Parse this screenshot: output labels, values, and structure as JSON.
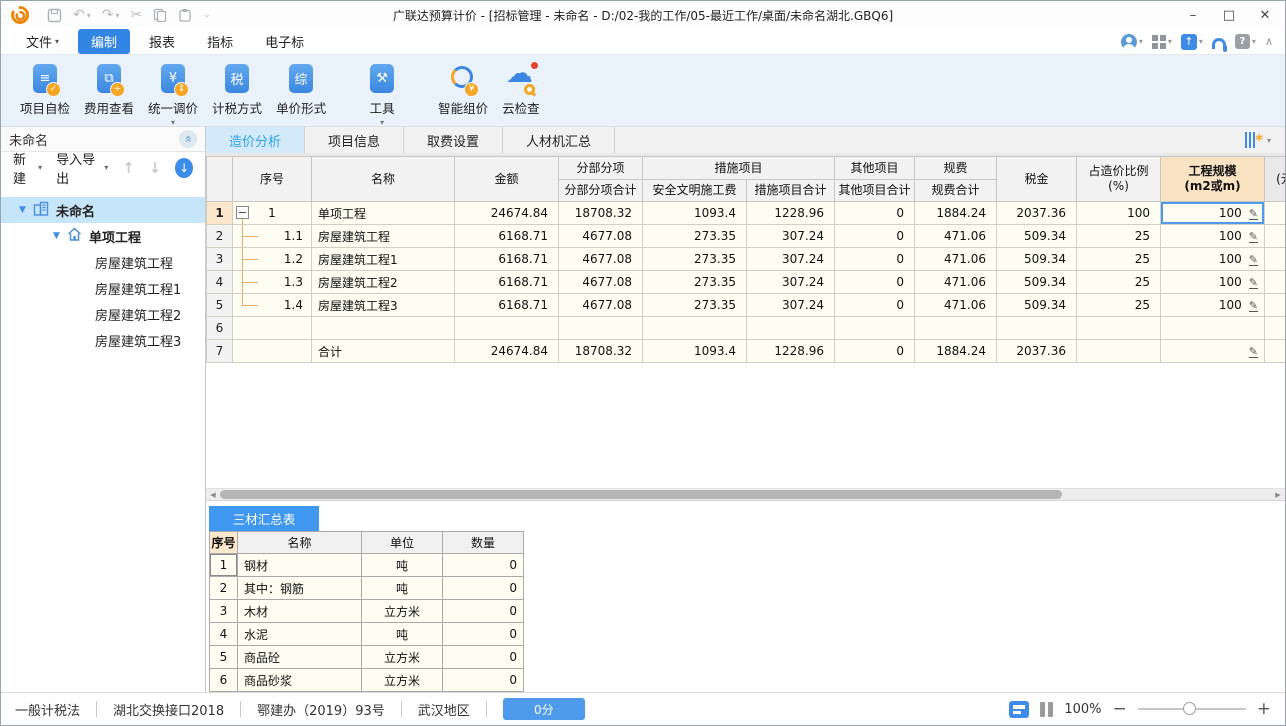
{
  "window": {
    "title": "广联达预算计价 - [招标管理 - 未命名 - D:/02-我的工作/05-最近工作/桌面/未命名湖北.GBQ6]",
    "controls": {
      "minimize": "–",
      "maximize": "□",
      "close": "✕"
    }
  },
  "menu": {
    "items": [
      {
        "label": "文件",
        "name": "file",
        "dropdown": true
      },
      {
        "label": "编制",
        "name": "edit",
        "active": true
      },
      {
        "label": "报表",
        "name": "report"
      },
      {
        "label": "指标",
        "name": "index"
      },
      {
        "label": "电子标",
        "name": "e-tender"
      }
    ]
  },
  "toolbar": {
    "buttons": [
      {
        "label": "项目自检",
        "name": "project-self-check",
        "icon": "doc-check"
      },
      {
        "label": "费用查看",
        "name": "fee-view",
        "icon": "fee-view"
      },
      {
        "label": "统一调价",
        "name": "unified-price-adjust",
        "icon": "adjust-price",
        "dropdown": true
      },
      {
        "label": "计税方式",
        "name": "tax-method",
        "icon": "tax-mode"
      },
      {
        "label": "单价形式",
        "name": "unit-price-form",
        "icon": "unit-price"
      },
      {
        "label": "工具",
        "name": "tools",
        "icon": "tools",
        "dropdown": true,
        "gap": true
      },
      {
        "label": "智能组价",
        "name": "smart-pricing",
        "icon": "smart-price",
        "gap": true
      },
      {
        "label": "云检查",
        "name": "cloud-check",
        "icon": "cloud-check",
        "red_dot": true
      }
    ]
  },
  "sidebar": {
    "header_title": "未命名",
    "actions": {
      "new_label": "新建",
      "import_export_label": "导入导出"
    },
    "tree": [
      {
        "label": "未命名",
        "name": "project-root",
        "level": 0,
        "icon": "building",
        "expanded": true,
        "selected": true
      },
      {
        "label": "单项工程",
        "name": "single-project",
        "level": 1,
        "icon": "home",
        "expanded": true
      },
      {
        "label": "房屋建筑工程",
        "name": "building-works",
        "level": 2
      },
      {
        "label": "房屋建筑工程1",
        "name": "building-works-1",
        "level": 2
      },
      {
        "label": "房屋建筑工程2",
        "name": "building-works-2",
        "level": 2
      },
      {
        "label": "房屋建筑工程3",
        "name": "building-works-3",
        "level": 2
      }
    ]
  },
  "tabs": {
    "items": [
      {
        "label": "造价分析",
        "name": "cost-analysis",
        "active": true
      },
      {
        "label": "项目信息",
        "name": "project-info"
      },
      {
        "label": "取费设置",
        "name": "fee-settings"
      },
      {
        "label": "人材机汇总",
        "name": "labor-material-summary"
      }
    ]
  },
  "main_table": {
    "headers": {
      "seq": "序号",
      "name": "名称",
      "amount": "金额",
      "fbfx_group": "分部分项",
      "fbfx_total": "分部分项合计",
      "csxm_group": "措施项目",
      "aqwm_fee": "安全文明施工费",
      "csxm_total": "措施项目合计",
      "qtxm_group": "其他项目",
      "qtxm_total": "其他项目合计",
      "gf_group": "规费",
      "gf_total": "规费合计",
      "tax": "税金",
      "ratio_line1": "占造价比例",
      "ratio_line2": "(%)",
      "scale_line1": "工程规模",
      "scale_line2": "(m2或m)",
      "partial": "(元"
    },
    "rows": [
      {
        "row": "1",
        "seq": "1",
        "name": "单项工程",
        "amount": "24674.84",
        "fbfx": "18708.32",
        "aqwm": "1093.4",
        "cs": "1228.96",
        "qt": "0",
        "gf": "1884.24",
        "tax": "2037.36",
        "ratio": "100",
        "scale": "100",
        "tree": "root",
        "pencil": true,
        "selected": true
      },
      {
        "row": "2",
        "seq": "1.1",
        "name": "房屋建筑工程",
        "amount": "6168.71",
        "fbfx": "4677.08",
        "aqwm": "273.35",
        "cs": "307.24",
        "qt": "0",
        "gf": "471.06",
        "tax": "509.34",
        "ratio": "25",
        "scale": "100",
        "tree": "mid",
        "pencil": true
      },
      {
        "row": "3",
        "seq": "1.2",
        "name": "房屋建筑工程1",
        "amount": "6168.71",
        "fbfx": "4677.08",
        "aqwm": "273.35",
        "cs": "307.24",
        "qt": "0",
        "gf": "471.06",
        "tax": "509.34",
        "ratio": "25",
        "scale": "100",
        "tree": "mid",
        "pencil": true
      },
      {
        "row": "4",
        "seq": "1.3",
        "name": "房屋建筑工程2",
        "amount": "6168.71",
        "fbfx": "4677.08",
        "aqwm": "273.35",
        "cs": "307.24",
        "qt": "0",
        "gf": "471.06",
        "tax": "509.34",
        "ratio": "25",
        "scale": "100",
        "tree": "mid",
        "pencil": true
      },
      {
        "row": "5",
        "seq": "1.4",
        "name": "房屋建筑工程3",
        "amount": "6168.71",
        "fbfx": "4677.08",
        "aqwm": "273.35",
        "cs": "307.24",
        "qt": "0",
        "gf": "471.06",
        "tax": "509.34",
        "ratio": "25",
        "scale": "100",
        "tree": "end",
        "pencil": true
      },
      {
        "row": "6",
        "seq": "",
        "name": "",
        "amount": "",
        "fbfx": "",
        "aqwm": "",
        "cs": "",
        "qt": "",
        "gf": "",
        "tax": "",
        "ratio": "",
        "scale": "",
        "tree": "none",
        "pencil": false
      },
      {
        "row": "7",
        "seq": "",
        "name": "合计",
        "amount": "24674.84",
        "fbfx": "18708.32",
        "aqwm": "1093.4",
        "cs": "1228.96",
        "qt": "0",
        "gf": "1884.24",
        "tax": "2037.36",
        "ratio": "",
        "scale": "",
        "tree": "none",
        "pencil": true
      }
    ]
  },
  "bottom_panel": {
    "tab": "三材汇总表",
    "headers": [
      "序号",
      "名称",
      "单位",
      "数量"
    ],
    "rows": [
      {
        "seq": "1",
        "name": "钢材",
        "unit": "吨",
        "qty": "0"
      },
      {
        "seq": "2",
        "name": "其中：钢筋",
        "unit": "吨",
        "qty": "0"
      },
      {
        "seq": "3",
        "name": "木材",
        "unit": "立方米",
        "qty": "0"
      },
      {
        "seq": "4",
        "name": "水泥",
        "unit": "吨",
        "qty": "0"
      },
      {
        "seq": "5",
        "name": "商品砼",
        "unit": "立方米",
        "qty": "0"
      },
      {
        "seq": "6",
        "name": "商品砂浆",
        "unit": "立方米",
        "qty": "0"
      }
    ]
  },
  "status_bar": {
    "items": [
      {
        "label": "一般计税法",
        "name": "tax-method"
      },
      {
        "label": "湖北交换接口2018",
        "name": "exchange-interface"
      },
      {
        "label": "鄂建办（2019）93号",
        "name": "document-number"
      },
      {
        "label": "武汉地区",
        "name": "region"
      }
    ],
    "score": "0分",
    "zoom_level": "100%"
  },
  "colors": {
    "accent_blue": "#3D8DE8",
    "menu_active": "#3385E4",
    "toolbar_bg": "#E9F1FB",
    "row_bg": "#FDFDF1",
    "selected_header": "#FAE3C2",
    "selected_rownum": "#FBE7CC",
    "tab_active_bg": "#D3EAFA",
    "tab_active_text": "#2FA3E6",
    "tree_selected": "#C7E5F8",
    "tree_line": "#F0A868",
    "score_button": "#4D9BEA",
    "badge_orange": "#F5A623",
    "red_dot": "#E8402E"
  }
}
